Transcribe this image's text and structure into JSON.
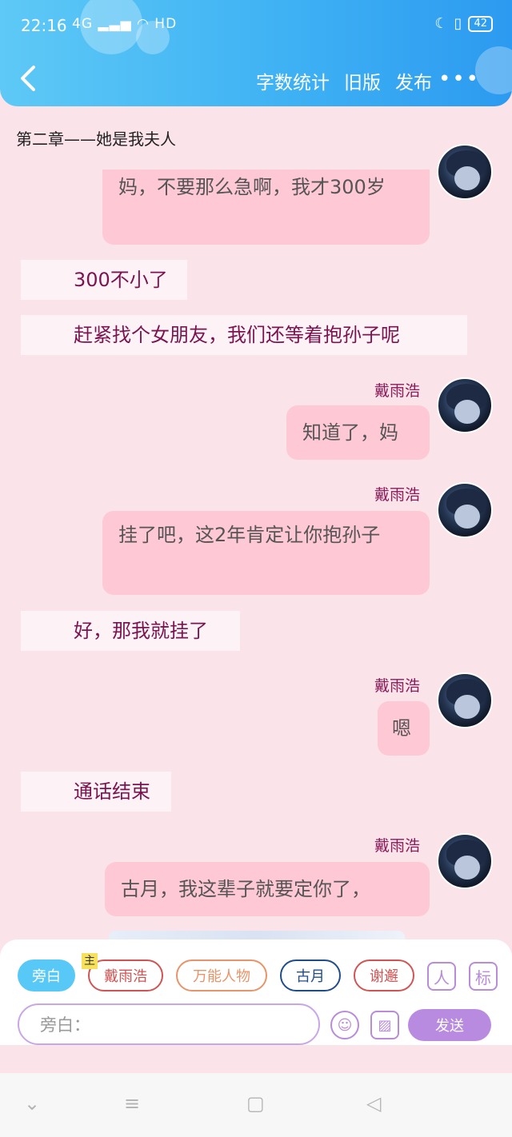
{
  "status": {
    "time": "22:16",
    "signal": "4G",
    "network": "HD",
    "battery": "42"
  },
  "header": {
    "actions": [
      "字数统计",
      "旧版",
      "发布"
    ],
    "more": "•••"
  },
  "chapter": {
    "title": "第二章——她是我夫人"
  },
  "messages": [
    {
      "speaker": "",
      "text": "妈，不要那么急啊，我才300岁"
    },
    {
      "text": "300不小了"
    },
    {
      "text": "赶紧找个女朋友，我们还等着抱孙子呢"
    },
    {
      "speaker": "戴雨浩",
      "text": "知道了，妈"
    },
    {
      "speaker": "戴雨浩",
      "text": "挂了吧，这2年肯定让你抱孙子"
    },
    {
      "text": "好，那我就挂了"
    },
    {
      "speaker": "戴雨浩",
      "text": "嗯"
    },
    {
      "text": "通话结束"
    },
    {
      "speaker": "戴雨浩",
      "text": "古月，我这辈子就要定你了，"
    }
  ],
  "composer": {
    "roles": [
      "旁白",
      "戴雨浩",
      "万能人物",
      "古月",
      "谢邂"
    ],
    "main_badge": "主",
    "tools": [
      "人",
      "标"
    ],
    "input_placeholder": "旁白：",
    "send_label": "发送"
  },
  "colors": {
    "header": "#3fb2f4",
    "background": "#fbe3ea",
    "bubble": "#fec8d5",
    "narration_text": "#7a1450",
    "send": "#b98be0"
  }
}
